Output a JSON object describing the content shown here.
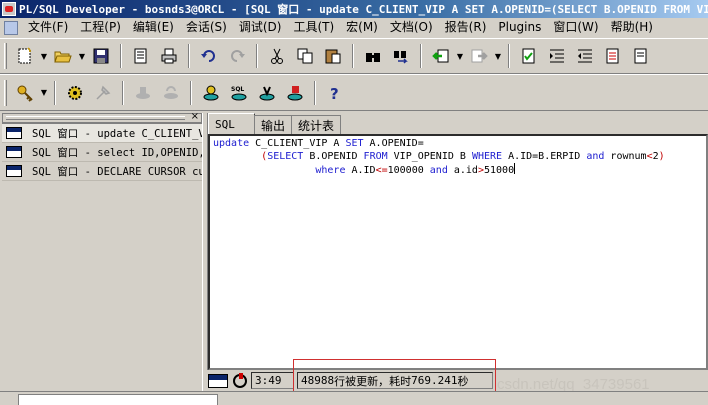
{
  "title": "PL/SQL Developer - bosnds3@ORCL - [SQL 窗口 - update C_CLIENT_VIP A SET A.OPENID=(SELECT B.OPENID FROM VIP_OPENID B WHERE A.ID=B.ERPID",
  "menu": [
    "文件(F)",
    "工程(P)",
    "编辑(E)",
    "会话(S)",
    "调试(D)",
    "工具(T)",
    "宏(M)",
    "文档(O)",
    "报告(R)",
    "Plugins",
    "窗口(W)",
    "帮助(H)"
  ],
  "toolbar1": [
    "new-icon",
    "open-icon",
    "save-icon",
    "print-preview-icon",
    "print-icon",
    "undo-icon",
    "redo-icon",
    "cut-icon",
    "copy-icon",
    "paste-icon",
    "find-icon",
    "find-next-icon",
    "back-icon",
    "forward-icon",
    "checklist-icon",
    "indent-icon",
    "unindent-icon",
    "comment-icon"
  ],
  "toolbar2": [
    "key-icon",
    "gear-icon",
    "pin-icon",
    "commit-icon",
    "rollback-icon",
    "db-icon",
    "sql-db-icon",
    "db-run-icon",
    "db-stop-icon",
    "help-icon"
  ],
  "window_list": [
    "SQL 窗口 - update C_CLIENT_VIP A SET A.OPENID=",
    "SQL 窗口 - select ID,OPENID,ERPID from VIP_OPENID",
    "SQL 窗口 - DECLARE CURSOR cur"
  ],
  "tabs": [
    "SQL",
    "输出",
    "统计表"
  ],
  "editor": {
    "line1_kw": "update",
    "line1_rest": " C_CLIENT_VIP A ",
    "line1_kw2": "SET",
    "line1_tail": " A.OPENID=",
    "line2_indent": "        ",
    "line2_open": "(",
    "line2_select": "SELECT",
    "line2_a": " B.OPENID ",
    "line2_from": "FROM",
    "line2_b": " VIP_OPENID B ",
    "line2_where": "WHERE",
    "line2_c": " A.ID=B.ERPID ",
    "line2_and": "and",
    "line2_d": " rownum",
    "line2_lt": "<",
    "line2_e": "2",
    "line2_close": ")",
    "line3_indent": "                 ",
    "line3_where": "where",
    "line3_a": " A.ID",
    "line3_le": "<=",
    "line3_b": "100000 ",
    "line3_and": "and",
    "line3_c": " a.id",
    "line3_gt": ">",
    "line3_d": "51000"
  },
  "status": {
    "time": "3:49",
    "rows": "48988",
    "message": " 行被更新，耗时 ",
    "duration": "769.241",
    "unit": " 秒"
  },
  "watermark": "csdn.net/qq_34739561",
  "colors": {
    "keyword": "#2020d0",
    "operator": "#c00000",
    "highlight": "#d03030"
  }
}
